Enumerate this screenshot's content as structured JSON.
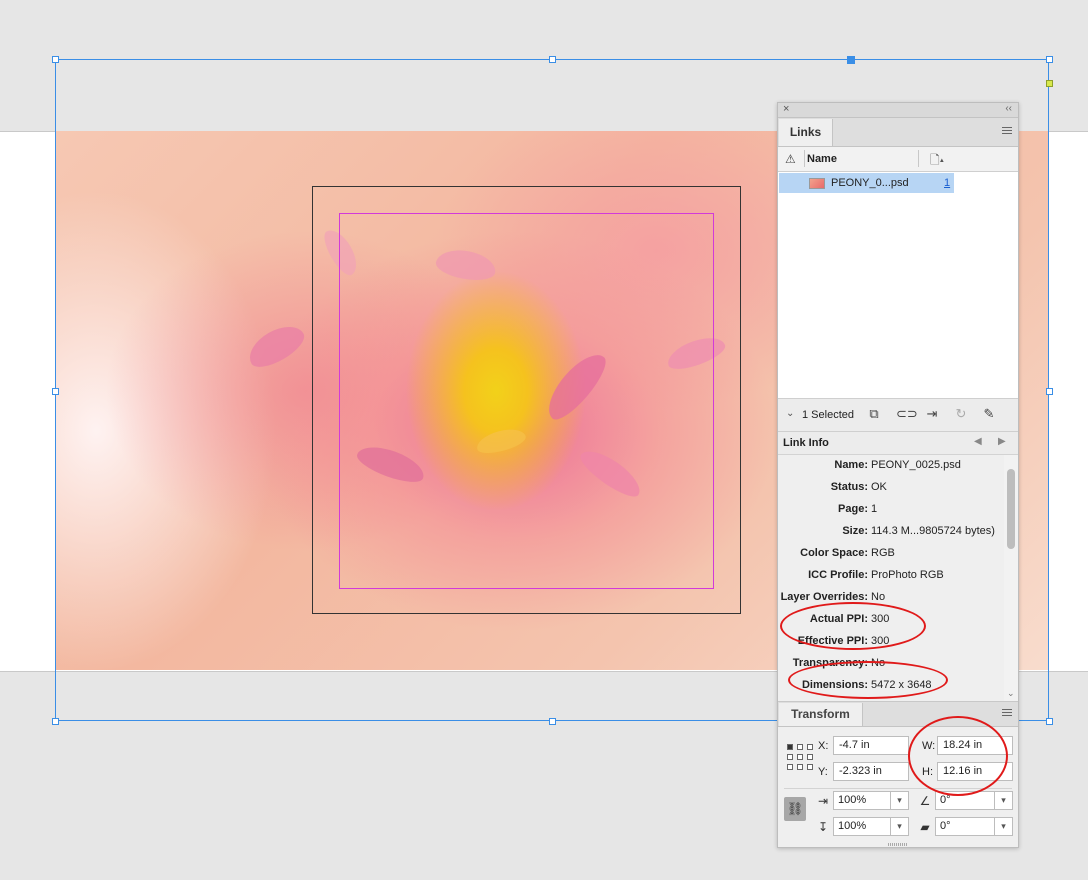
{
  "links_panel": {
    "tab_label": "Links",
    "column_name": "Name",
    "file_row": {
      "name": "PEONY_0...psd",
      "page": "1"
    },
    "selected_text": "1 Selected"
  },
  "link_info": {
    "title": "Link Info",
    "rows": [
      {
        "label": "Name:",
        "value": "PEONY_0025.psd"
      },
      {
        "label": "Status:",
        "value": "OK"
      },
      {
        "label": "Page:",
        "value": "1"
      },
      {
        "label": "Size:",
        "value": "114.3 M...9805724 bytes)"
      },
      {
        "label": "Color Space:",
        "value": "RGB"
      },
      {
        "label": "ICC Profile:",
        "value": "ProPhoto RGB"
      },
      {
        "label": "Layer Overrides:",
        "value": "No"
      },
      {
        "label": "Actual PPI:",
        "value": "300"
      },
      {
        "label": "Effective PPI:",
        "value": "300"
      },
      {
        "label": "Transparency:",
        "value": "No"
      },
      {
        "label": "Dimensions:",
        "value": "5472 x 3648"
      }
    ]
  },
  "transform": {
    "tab_label": "Transform",
    "x_label": "X:",
    "x_value": "-4.7 in",
    "y_label": "Y:",
    "y_value": "-2.323 in",
    "w_label": "W:",
    "w_value": "18.24 in",
    "h_label": "H:",
    "h_value": "12.16 in",
    "scale_x": "100%",
    "scale_y": "100%",
    "rotate": "0°",
    "shear": "0°"
  },
  "colors": {
    "selection": "#3a8ee6",
    "annotation": "#e01a1a",
    "inner_frame": "#d23ad9",
    "row_highlight": "#b7d5f4"
  }
}
